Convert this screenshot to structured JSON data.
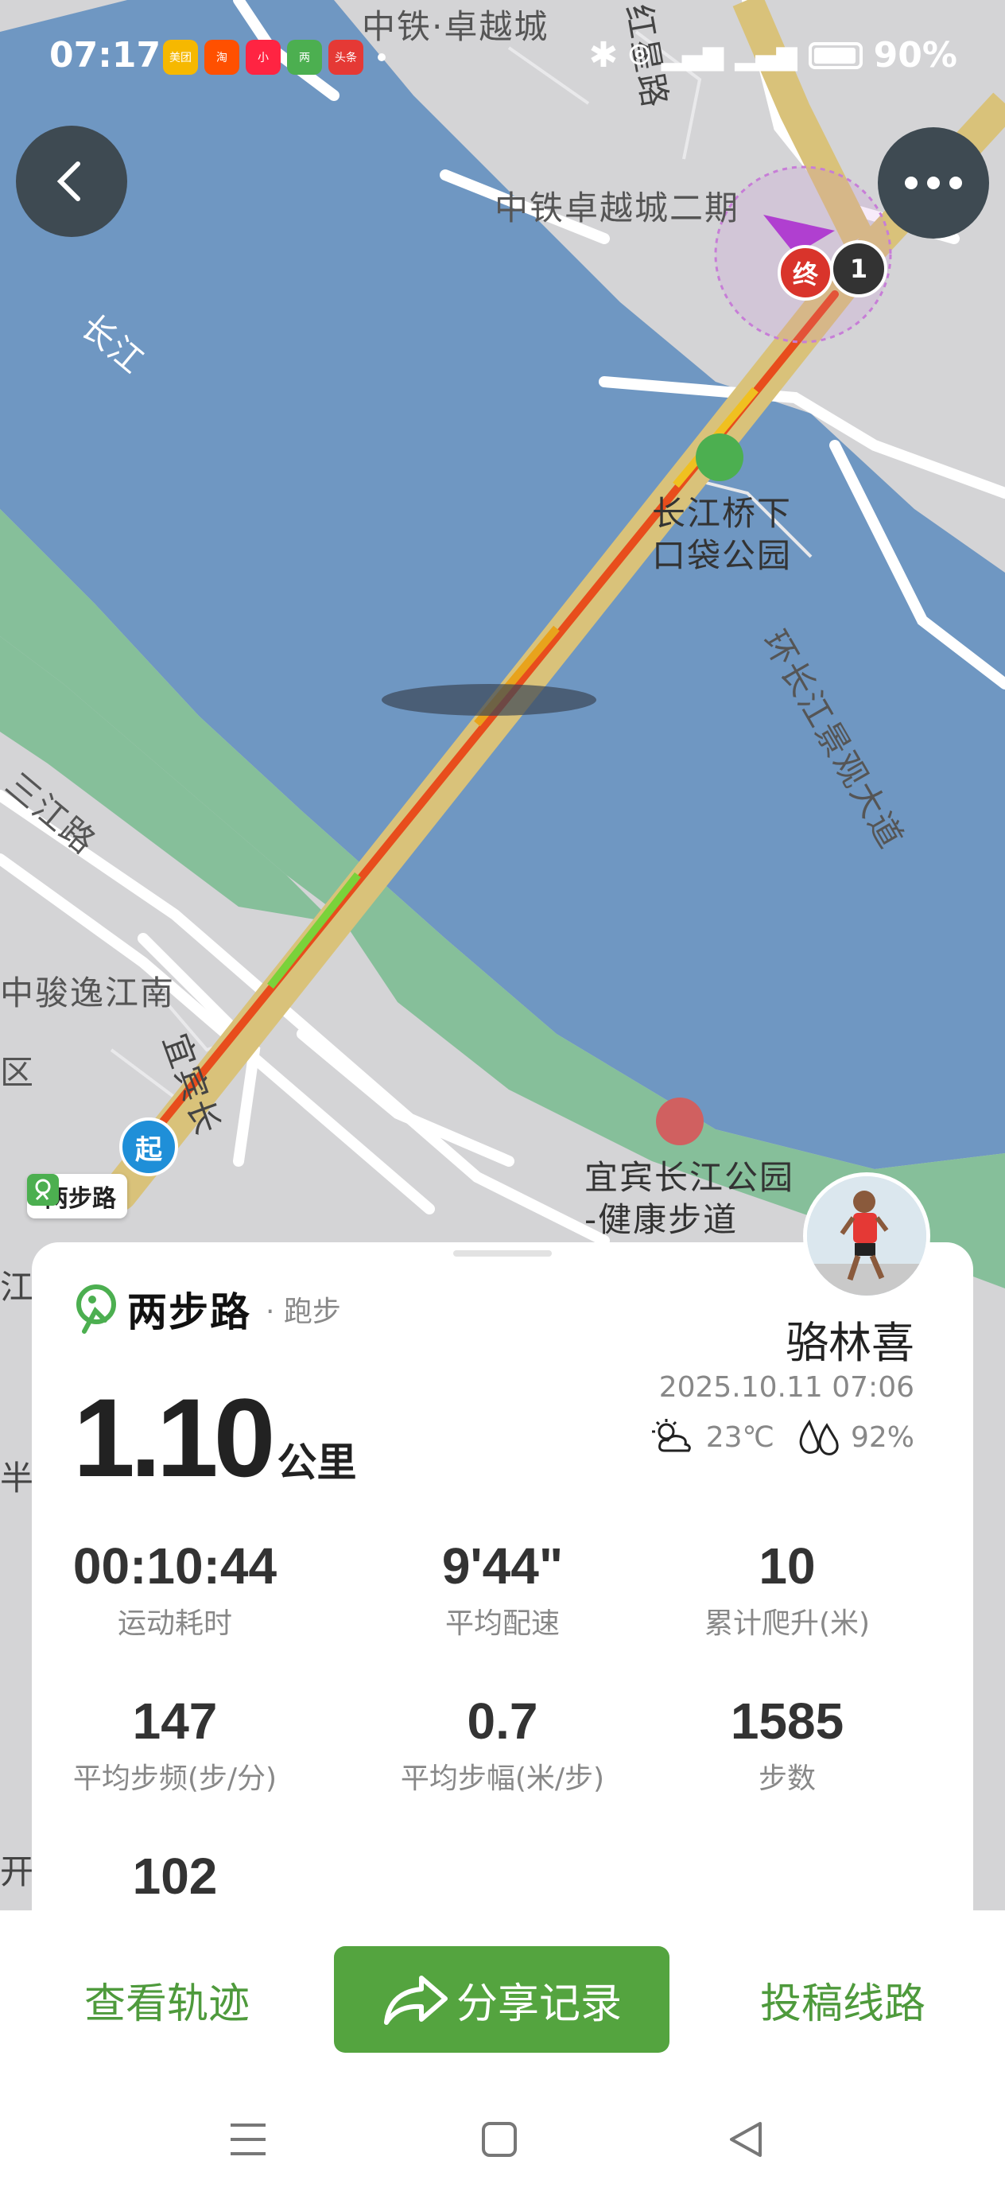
{
  "status_bar": {
    "time": "07:17",
    "battery": "90%",
    "apps": [
      {
        "label": "美团",
        "color": "#f6b800"
      },
      {
        "label": "淘",
        "color": "#ff5000"
      },
      {
        "label": "小",
        "color": "#ff2442"
      },
      {
        "label": "两",
        "color": "#4caf50"
      },
      {
        "label": "头条",
        "color": "#e53935"
      }
    ]
  },
  "map": {
    "labels": {
      "l1": "中铁·卓越城",
      "l2": "中铁卓越城二期",
      "l3": "长江",
      "l4": "长江桥下\n口袋公园",
      "l5": "环长江景观大道",
      "l6": "三江路",
      "l7": "中骏逸江南",
      "l8": "区",
      "l9": "宜宾长江公园\n-健康步道",
      "l10": "红星路",
      "l11": "宜宾长",
      "l12": "江",
      "l13": "半",
      "l14": "开"
    },
    "start_label": "起",
    "end_label": "终",
    "km_marker": "1",
    "badge": "两步路"
  },
  "card": {
    "brand_name": "两步路",
    "activity": "· 跑步",
    "user_name": "骆林喜",
    "datetime": "2025.10.11 07:06",
    "temperature": "23℃",
    "humidity": "92%",
    "distance": "1.10",
    "distance_unit": "公里",
    "stats": [
      {
        "value": "00:10:44",
        "label": "运动耗时"
      },
      {
        "value": "9'44\"",
        "label": "平均配速"
      },
      {
        "value": "10",
        "label": "累计爬升(米)"
      },
      {
        "value": "147",
        "label": "平均步频(步/分)"
      },
      {
        "value": "0.7",
        "label": "平均步幅(米/步)"
      },
      {
        "value": "1585",
        "label": "步数"
      },
      {
        "value": "102",
        "label": ""
      }
    ]
  },
  "actions": {
    "view_track": "查看轨迹",
    "share": "分享记录",
    "submit_route": "投稿线路"
  },
  "colors": {
    "water": "#6f97c2",
    "park": "#86bf9a",
    "accent_green": "#54a43f"
  }
}
